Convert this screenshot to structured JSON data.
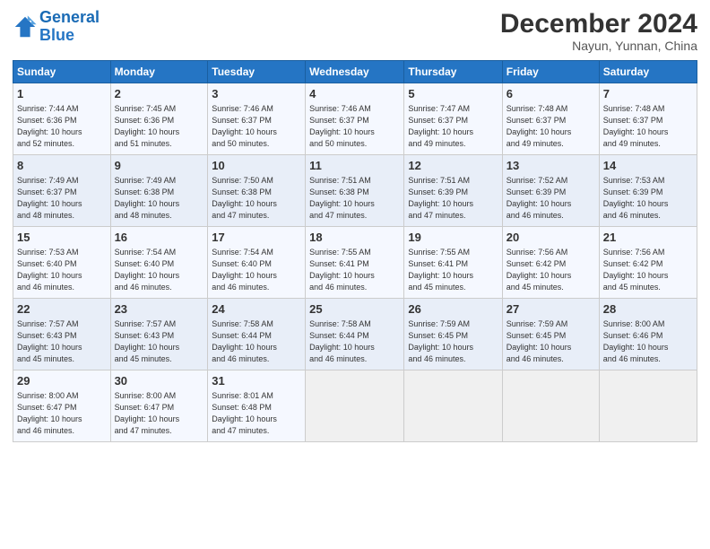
{
  "logo": {
    "line1": "General",
    "line2": "Blue"
  },
  "title": "December 2024",
  "location": "Nayun, Yunnan, China",
  "days_of_week": [
    "Sunday",
    "Monday",
    "Tuesday",
    "Wednesday",
    "Thursday",
    "Friday",
    "Saturday"
  ],
  "weeks": [
    [
      {
        "day": "1",
        "info": "Sunrise: 7:44 AM\nSunset: 6:36 PM\nDaylight: 10 hours\nand 52 minutes."
      },
      {
        "day": "2",
        "info": "Sunrise: 7:45 AM\nSunset: 6:36 PM\nDaylight: 10 hours\nand 51 minutes."
      },
      {
        "day": "3",
        "info": "Sunrise: 7:46 AM\nSunset: 6:37 PM\nDaylight: 10 hours\nand 50 minutes."
      },
      {
        "day": "4",
        "info": "Sunrise: 7:46 AM\nSunset: 6:37 PM\nDaylight: 10 hours\nand 50 minutes."
      },
      {
        "day": "5",
        "info": "Sunrise: 7:47 AM\nSunset: 6:37 PM\nDaylight: 10 hours\nand 49 minutes."
      },
      {
        "day": "6",
        "info": "Sunrise: 7:48 AM\nSunset: 6:37 PM\nDaylight: 10 hours\nand 49 minutes."
      },
      {
        "day": "7",
        "info": "Sunrise: 7:48 AM\nSunset: 6:37 PM\nDaylight: 10 hours\nand 49 minutes."
      }
    ],
    [
      {
        "day": "8",
        "info": "Sunrise: 7:49 AM\nSunset: 6:37 PM\nDaylight: 10 hours\nand 48 minutes."
      },
      {
        "day": "9",
        "info": "Sunrise: 7:49 AM\nSunset: 6:38 PM\nDaylight: 10 hours\nand 48 minutes."
      },
      {
        "day": "10",
        "info": "Sunrise: 7:50 AM\nSunset: 6:38 PM\nDaylight: 10 hours\nand 47 minutes."
      },
      {
        "day": "11",
        "info": "Sunrise: 7:51 AM\nSunset: 6:38 PM\nDaylight: 10 hours\nand 47 minutes."
      },
      {
        "day": "12",
        "info": "Sunrise: 7:51 AM\nSunset: 6:39 PM\nDaylight: 10 hours\nand 47 minutes."
      },
      {
        "day": "13",
        "info": "Sunrise: 7:52 AM\nSunset: 6:39 PM\nDaylight: 10 hours\nand 46 minutes."
      },
      {
        "day": "14",
        "info": "Sunrise: 7:53 AM\nSunset: 6:39 PM\nDaylight: 10 hours\nand 46 minutes."
      }
    ],
    [
      {
        "day": "15",
        "info": "Sunrise: 7:53 AM\nSunset: 6:40 PM\nDaylight: 10 hours\nand 46 minutes."
      },
      {
        "day": "16",
        "info": "Sunrise: 7:54 AM\nSunset: 6:40 PM\nDaylight: 10 hours\nand 46 minutes."
      },
      {
        "day": "17",
        "info": "Sunrise: 7:54 AM\nSunset: 6:40 PM\nDaylight: 10 hours\nand 46 minutes."
      },
      {
        "day": "18",
        "info": "Sunrise: 7:55 AM\nSunset: 6:41 PM\nDaylight: 10 hours\nand 46 minutes."
      },
      {
        "day": "19",
        "info": "Sunrise: 7:55 AM\nSunset: 6:41 PM\nDaylight: 10 hours\nand 45 minutes."
      },
      {
        "day": "20",
        "info": "Sunrise: 7:56 AM\nSunset: 6:42 PM\nDaylight: 10 hours\nand 45 minutes."
      },
      {
        "day": "21",
        "info": "Sunrise: 7:56 AM\nSunset: 6:42 PM\nDaylight: 10 hours\nand 45 minutes."
      }
    ],
    [
      {
        "day": "22",
        "info": "Sunrise: 7:57 AM\nSunset: 6:43 PM\nDaylight: 10 hours\nand 45 minutes."
      },
      {
        "day": "23",
        "info": "Sunrise: 7:57 AM\nSunset: 6:43 PM\nDaylight: 10 hours\nand 45 minutes."
      },
      {
        "day": "24",
        "info": "Sunrise: 7:58 AM\nSunset: 6:44 PM\nDaylight: 10 hours\nand 46 minutes."
      },
      {
        "day": "25",
        "info": "Sunrise: 7:58 AM\nSunset: 6:44 PM\nDaylight: 10 hours\nand 46 minutes."
      },
      {
        "day": "26",
        "info": "Sunrise: 7:59 AM\nSunset: 6:45 PM\nDaylight: 10 hours\nand 46 minutes."
      },
      {
        "day": "27",
        "info": "Sunrise: 7:59 AM\nSunset: 6:45 PM\nDaylight: 10 hours\nand 46 minutes."
      },
      {
        "day": "28",
        "info": "Sunrise: 8:00 AM\nSunset: 6:46 PM\nDaylight: 10 hours\nand 46 minutes."
      }
    ],
    [
      {
        "day": "29",
        "info": "Sunrise: 8:00 AM\nSunset: 6:47 PM\nDaylight: 10 hours\nand 46 minutes."
      },
      {
        "day": "30",
        "info": "Sunrise: 8:00 AM\nSunset: 6:47 PM\nDaylight: 10 hours\nand 47 minutes."
      },
      {
        "day": "31",
        "info": "Sunrise: 8:01 AM\nSunset: 6:48 PM\nDaylight: 10 hours\nand 47 minutes."
      },
      {
        "day": "",
        "info": ""
      },
      {
        "day": "",
        "info": ""
      },
      {
        "day": "",
        "info": ""
      },
      {
        "day": "",
        "info": ""
      }
    ]
  ]
}
